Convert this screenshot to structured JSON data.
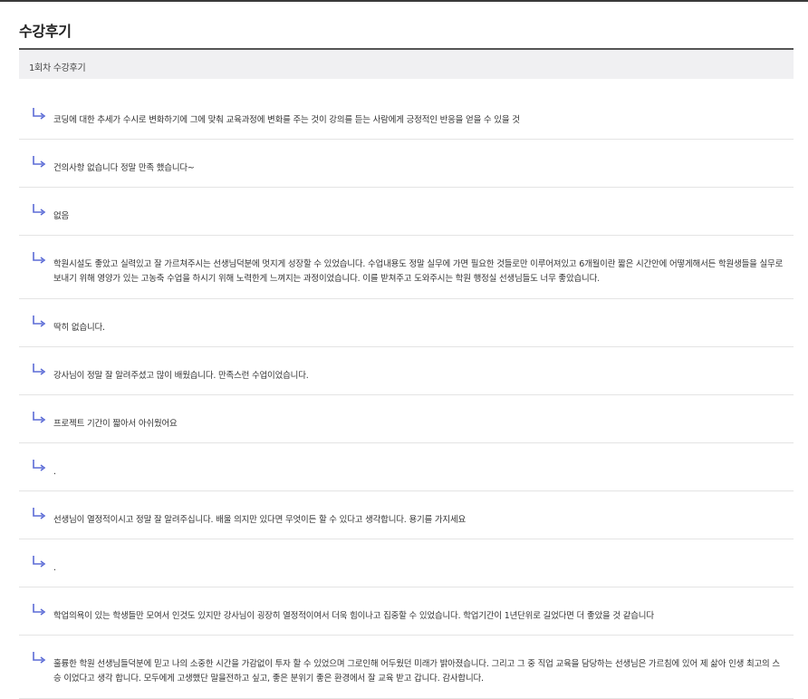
{
  "page": {
    "title": "수강후기",
    "round_label": "1회차 수강후기"
  },
  "colors": {
    "arrow": "#5b6bd6",
    "header_bg": "#f0f0f2",
    "divider": "#e4e4e4"
  },
  "reviews": [
    {
      "text": "코딩에 대한 추세가 수시로 변화하기에 그에 맞춰 교육과정에 변화를 주는 것이 강의를 듣는 사람에게 긍정적인 반응을 얻을 수 있을 것"
    },
    {
      "text": "건의사항 없습니다 정말 만족 했습니다~"
    },
    {
      "text": "없음"
    },
    {
      "text": "학원시설도 좋았고 실력있고 잘 가르쳐주시는 선생님덕분에 멋지게 성장할 수 있었습니다. 수업내용도 정말 실무에 가면 필요한 것들로만 이루어져있고 6개월이란 짧은 시간안에 어떻게해서든 학원생들을 실무로 보내기 위해 영양가 있는 고농축 수업을 하시기 위해 노력한게 느껴지는 과정이었습니다. 이를 받쳐주고 도와주시는 학원 행정실 선생님들도 너무 좋았습니다."
    },
    {
      "text": "딱히 없습니다."
    },
    {
      "text": "강사님이 정말 잘 알려주셨고 많이 배웠습니다. 만족스런 수업이었습니다."
    },
    {
      "text": "프로젝트 기간이 짧아서 아쉬웠어요"
    },
    {
      "text": "."
    },
    {
      "text": "선생님이 열정적이시고 정말 잘 알려주십니다. 배울 의지만 있다면 무엇이든 할 수 있다고 생각합니다. 용기를 가지세요"
    },
    {
      "text": "."
    },
    {
      "text": "학업의욕이 있는 학생들만 모여서 인것도 있지만 강사님이 굉장히 열정적이여서 더욱 힘이나고 집중할 수 있었습니다. 학업기간이 1년단위로 길었다면 더 좋았을 것 같습니다"
    },
    {
      "text": "훌륭한 학원 선생님들덕분에 믿고 나의 소중한 시간을 가감없이 투자 할 수 있었으며 그로인해 어두웠던 미래가 밝아졌습니다. 그리고 그 중 직업 교육을 담당하는 선생님은 가르침에 있어 제 삶아 인생 최고의 스승 이었다고 생각 합니다. 모두에게 고생했단 말을전하고 싶고, 좋은 분위기 좋은 환경에서 잘 교육 받고 갑니다. 감사합니다."
    }
  ]
}
